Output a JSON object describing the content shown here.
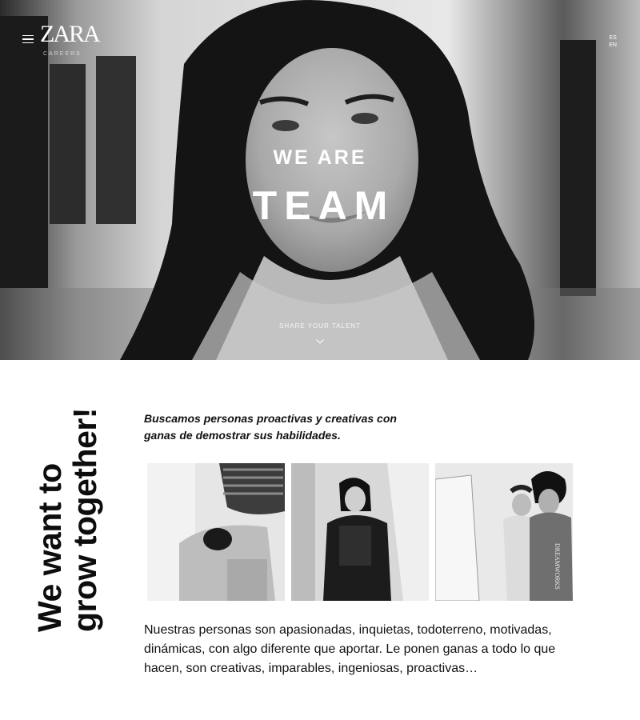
{
  "header": {
    "logo_text": "ZARA",
    "logo_subtext": "CAREERS",
    "languages": [
      "ES",
      "EN"
    ]
  },
  "hero": {
    "kicker": "WE ARE",
    "title": "TEAM",
    "cta": "SHARE YOUR TALENT",
    "scroll_icon": "chevron-down-icon"
  },
  "section": {
    "vertical_heading_line1": "We want to",
    "vertical_heading_line2": "grow together!",
    "intro": "Buscamos personas proactivas y creativas con ganas de demostrar sus habilidades.",
    "body": "Nuestras personas son apasionadas, inquietas, todoterreno, motivadas, dinámicas, con algo diferente que aportar. Le ponen ganas a todo lo que hacen, son creativas, imparables, ingeniosas, proactivas…",
    "photo3_sweatshirt_text": "DREAMWORKS"
  },
  "colors": {
    "text": "#111111",
    "background": "#ffffff",
    "hero_text": "#ffffff"
  }
}
